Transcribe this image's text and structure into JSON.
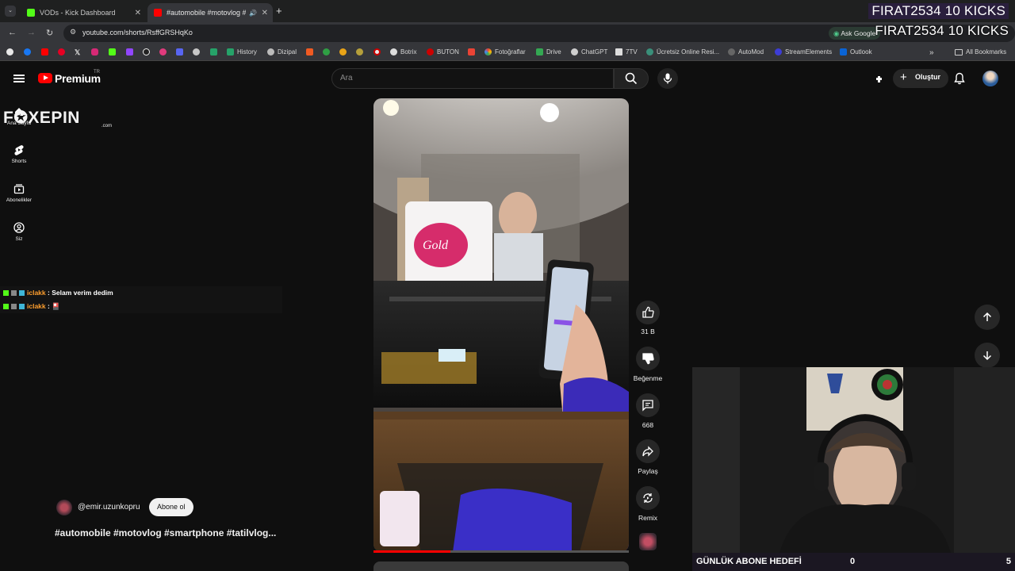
{
  "browser": {
    "tabs": [
      {
        "title": "VODs - Kick Dashboard",
        "active": false
      },
      {
        "title": "#automobile #motovlog #...",
        "active": true
      }
    ],
    "url": "youtube.com/shorts/RsffGRSHqKo",
    "ask_google": "Ask Google",
    "bookmarks": [
      "History",
      "Dizipal",
      "Botrix",
      "BUTON",
      "Fotoğraflar",
      "Drive",
      "ChatGPT",
      "7TV",
      "Ücretsiz Online Resi...",
      "AutoMod",
      "StreamElements",
      "Outlook"
    ],
    "all_bookmarks": "All Bookmarks"
  },
  "overlay": {
    "kicks_line": "FIRAT2534  10 KICKS",
    "logo_main": "F✪XEPIN",
    "logo_sub": ".com",
    "goal_label": "GÜNLÜK ABONE HEDEFİ",
    "goal_current": "0",
    "goal_target": "5",
    "goal_progress_fraction": 0.0
  },
  "chat": [
    {
      "user": "iclakk",
      "message": "Selam verim dedim"
    },
    {
      "user": "iclakk",
      "message": "🎴"
    }
  ],
  "youtube": {
    "brand": "Premium",
    "region": "TR",
    "search_placeholder": "Ara",
    "create_label": "Oluştur",
    "nav": [
      {
        "label": "Ana Sayfa",
        "icon": "home-icon"
      },
      {
        "label": "Shorts",
        "icon": "shorts-icon"
      },
      {
        "label": "Abonelikler",
        "icon": "subscriptions-icon"
      },
      {
        "label": "Siz",
        "icon": "you-icon"
      }
    ],
    "actions": {
      "like_count": "31 B",
      "dislike_label": "Beğenme",
      "comment_count": "668",
      "share_label": "Paylaş",
      "remix_label": "Remix"
    },
    "channel": "@emir.uzunkopru",
    "subscribe_label": "Abone ol",
    "caption": "#automobile #motovlog #smartphone #tatilvlog...",
    "video_progress_fraction": 0.3
  },
  "colors": {
    "accent": "#ff0000",
    "chat_user": "#ff9f2e",
    "goal_bar": "#4b2b7f",
    "kick_green": "#53fc18"
  }
}
